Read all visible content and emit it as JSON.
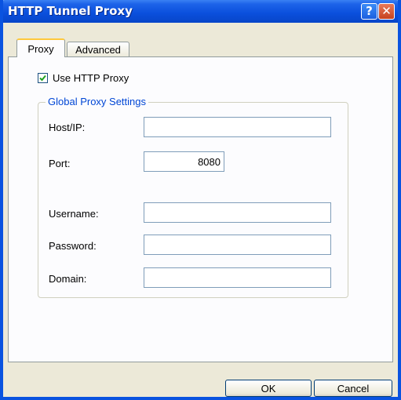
{
  "window": {
    "title": "HTTP Tunnel Proxy"
  },
  "titlebar": {
    "help_glyph": "?",
    "close_glyph": "✕"
  },
  "tabs": [
    {
      "label": "Proxy",
      "active": true
    },
    {
      "label": "Advanced",
      "active": false
    }
  ],
  "proxy": {
    "use_http_proxy": {
      "label": "Use HTTP Proxy",
      "checked": true
    },
    "group_title": "Global Proxy Settings",
    "fields": {
      "host": {
        "label": "Host/IP:",
        "value": ""
      },
      "port": {
        "label": "Port:",
        "value": "8080"
      },
      "username": {
        "label": "Username:",
        "value": ""
      },
      "password": {
        "label": "Password:",
        "value": ""
      },
      "domain": {
        "label": "Domain:",
        "value": ""
      }
    }
  },
  "buttons": {
    "ok": "OK",
    "cancel": "Cancel"
  },
  "colors": {
    "titlebar": "#0a4fdc",
    "group_title": "#0046d5",
    "check_mark": "#21a121",
    "tab_highlight": "#ffc83c"
  }
}
